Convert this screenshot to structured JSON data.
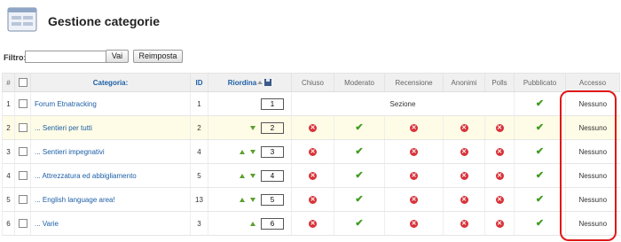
{
  "header": {
    "title": "Gestione categorie",
    "icon": "category-manager-icon"
  },
  "filter": {
    "label": "Filtro:",
    "value": "",
    "go_label": "Vai",
    "reset_label": "Reimposta"
  },
  "table": {
    "columns": {
      "num": "#",
      "category": "Categoria:",
      "id": "ID",
      "order": "Riordina",
      "locked": "Chiuso",
      "moderated": "Moderato",
      "review": "Recensione",
      "anonymous": "Anonimi",
      "polls": "Polls",
      "published": "Pubblicato",
      "access": "Accesso"
    },
    "rows": [
      {
        "num": "1",
        "name": "Forum Etnatracking",
        "id": "1",
        "order": "1",
        "section_label": "Sezione",
        "access": "Nessuno"
      },
      {
        "num": "2",
        "name": "... Sentieri per tutti",
        "id": "2",
        "order": "2",
        "access": "Nessuno"
      },
      {
        "num": "3",
        "name": "... Sentieri impegnativi",
        "id": "4",
        "order": "3",
        "access": "Nessuno"
      },
      {
        "num": "4",
        "name": "... Attrezzatura ed abbigliamento",
        "id": "5",
        "order": "4",
        "access": "Nessuno"
      },
      {
        "num": "5",
        "name": "... English language area!",
        "id": "13",
        "order": "5",
        "access": "Nessuno"
      },
      {
        "num": "6",
        "name": "... Varie",
        "id": "3",
        "order": "6",
        "access": "Nessuno"
      }
    ]
  },
  "colors": {
    "link": "#1d5fa6",
    "ok": "#3e9c1e",
    "no": "#d8333a",
    "highlight": "#e01818",
    "alt_row": "#fefce6"
  }
}
